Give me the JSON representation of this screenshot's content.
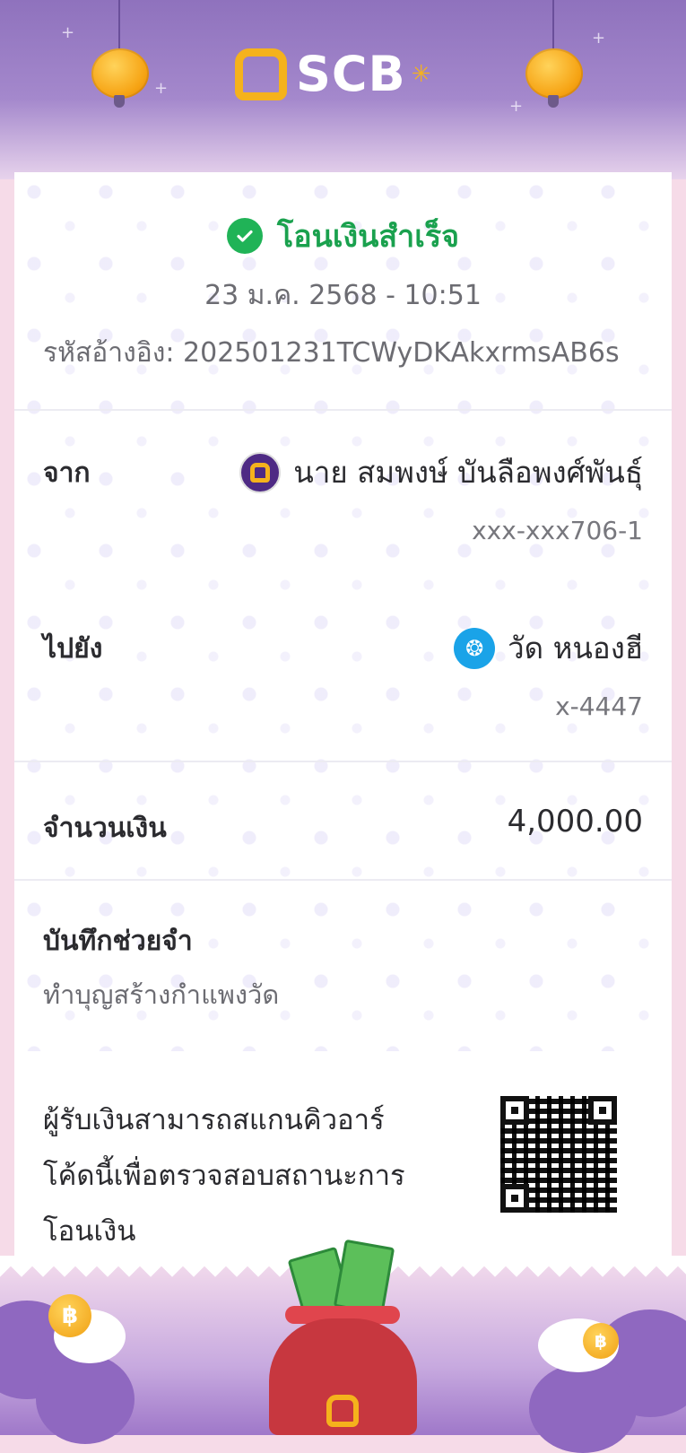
{
  "header": {
    "brand": "SCB"
  },
  "transfer": {
    "status": "โอนเงินสำเร็จ",
    "datetime": "23 ม.ค. 2568 - 10:51",
    "reference": "รหัสอ้างอิง: 202501231TCWyDKAkxrmsAB6s"
  },
  "from": {
    "label": "จาก",
    "name": "นาย สมพงษ์ บันลือพงศ์พันธุ์",
    "account": "xxx-xxx706-1"
  },
  "to": {
    "label": "ไปยัง",
    "name": "วัด หนองฮี",
    "account": "x-4447"
  },
  "amount": {
    "label": "จำนวนเงิน",
    "value": "4,000.00"
  },
  "memo": {
    "label": "บันทึกช่วยจำ",
    "text": "ทำบุญสร้างกำแพงวัด"
  },
  "qr": {
    "line1": "ผู้รับเงินสามารถสแกนคิวอาร์",
    "line2": "โค้ดนี้เพื่อตรวจสอบสถานะการ",
    "line3": "โอนเงิน"
  },
  "colors": {
    "success": "#1aa14e",
    "brand_purple": "#4e2a84",
    "brand_gold": "#f5b21c",
    "ktb_blue": "#1aa3e8"
  },
  "icons": {
    "status": "check-circle-icon",
    "from_bank": "scb-bank-icon",
    "to_bank": "ktb-bank-icon"
  }
}
